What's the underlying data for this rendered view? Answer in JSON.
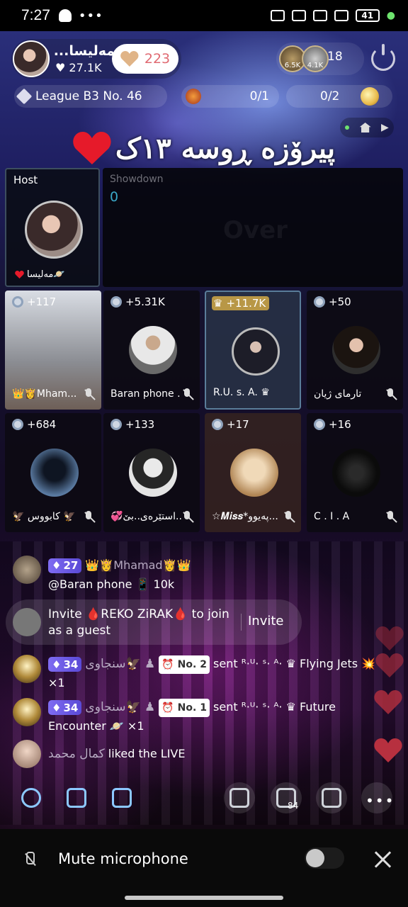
{
  "status_bar": {
    "time": "7:27",
    "dots": "•••",
    "battery": "41"
  },
  "header": {
    "host_name": "مەلیسا...",
    "host_likes": "♥ 27.1K",
    "like_count": "223",
    "viewer1_badge": "6.5K",
    "viewer2_badge": "4.1K",
    "viewer_count": "18",
    "league": "League B3 No. 46",
    "battle_score": "0/1",
    "coin_score": "0/2"
  },
  "title": "پیرۆزە ڕوسە ١٣ک",
  "host_tile": {
    "label": "Host",
    "name": "مەلیسا🪐"
  },
  "showdown": {
    "label": "Showdown",
    "score": "0",
    "overlay": "Over"
  },
  "guests": [
    {
      "score": "+117",
      "name": "👑👸Mham..."
    },
    {
      "score": "+5.31K",
      "name": "Baran phone ..."
    },
    {
      "score": "+11.7K",
      "name": "R.U. s. A. ♛"
    },
    {
      "score": "+50",
      "name": "تارمای ژیان"
    },
    {
      "score": "+684",
      "name": "🦅 کابووس 🦅"
    },
    {
      "score": "+133",
      "name": "💞استێرەی..بێ..."
    },
    {
      "score": "+17",
      "name": "☆𝑴𝒊𝒔𝒔*پەیوو..."
    },
    {
      "score": "+16",
      "name": "C . I . A"
    }
  ],
  "chat": {
    "msg1_level": "27",
    "msg1_name": "👑👸Mhamad👸👑",
    "msg1_text": "@Baran phone 📱 10k",
    "invite_text": "Invite 🩸REKO ZiRAK🩸 to join as a guest",
    "invite_button": "Invite",
    "msg2_level": "34",
    "msg2_name": "سنجاوی🦅 ♟",
    "msg2_rank": "⏰ No. 2",
    "msg2_text": "sent ᴿ·ᵁ· ˢ· ᴬ· ♛ Flying Jets 💥 ×1",
    "msg3_level": "34",
    "msg3_name": "سنجاوی🦅 ♟",
    "msg3_rank": "⏰ No. 1",
    "msg3_text": "sent ᴿ·ᵁ· ˢ· ᴬ· ♛ Future Encounter 🪐 ×1",
    "msg4_name": "کمال محمد",
    "msg4_text": "liked the LIVE"
  },
  "toolbar": {
    "share_count": "84",
    "more": "•••"
  },
  "bottom": {
    "mute_label": "Mute microphone"
  },
  "colors": {
    "accent": "#8cc8ff",
    "gem": "#7f6cf2",
    "heart": "#e61a2a",
    "highlight": "#d2aa46"
  }
}
